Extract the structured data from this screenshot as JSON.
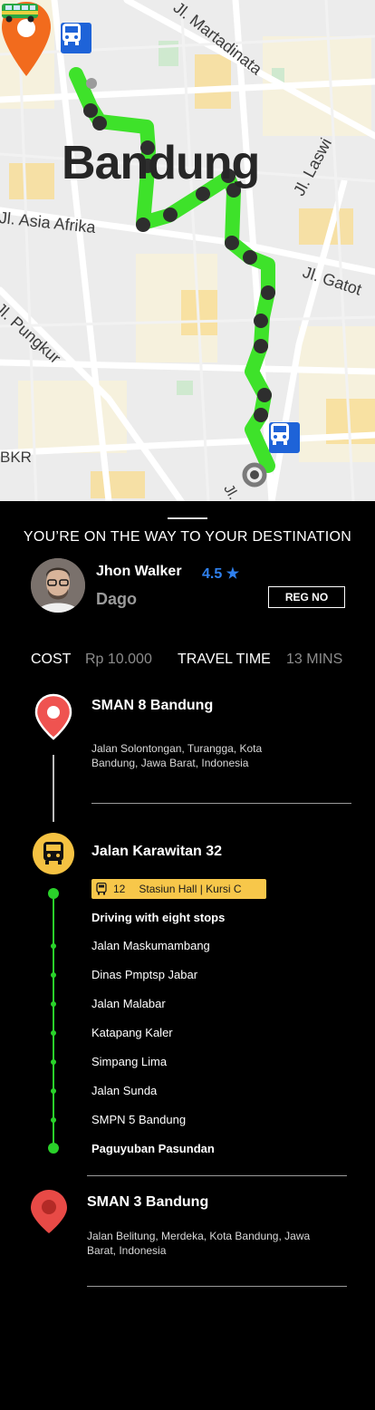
{
  "map": {
    "city_label": "Bandung",
    "street_labels": {
      "asia_afrika": "Jl. Asia Afrika",
      "laswi": "Jl. Laswi",
      "gatot": "Jl. Gatot",
      "pungkur": "Jl. Pungkur",
      "martadinata": "Jl. Martadinata",
      "bkr": "BKR",
      "jl": "Jl."
    },
    "route_color": "#3ee22a",
    "bus_stop_color": "#1e63d8",
    "destination_pin_color": "#f26b1d"
  },
  "trip": {
    "status_title": "YOU’RE ON THE WAY TO YOUR DESTINATION",
    "driver": {
      "name": "Jhon Walker",
      "rating": "4.5 ★",
      "area": "Dago",
      "reg_button": "REG NO"
    },
    "cost_label": "COST",
    "cost_value": "Rp 10.000",
    "travel_time_label": "TRAVEL TIME",
    "travel_time_value": "13 MINS"
  },
  "itinerary": {
    "origin": {
      "title": "SMAN 8 Bandung",
      "address": "Jalan Solontongan, Turangga, Kota Bandung, Jawa Barat, Indonesia"
    },
    "transit": {
      "title": "Jalan Karawitan 32",
      "route_number": "12",
      "route_desc": "Stasiun Hall | Kursi C",
      "summary": "Driving with eight stops",
      "stops": [
        "Jalan Maskumambang",
        "Dinas Pmptsp Jabar",
        "Jalan Malabar",
        "Katapang Kaler",
        "Simpang Lima",
        "Jalan Sunda",
        "SMPN 5 Bandung"
      ],
      "final_stop": "Paguyuban Pasundan",
      "line_color": "#2ad12a",
      "badge_color": "#f7c74a"
    },
    "destination": {
      "title": "SMAN 3 Bandung",
      "address": "Jalan Belitung, Merdeka, Kota Bandung, Jawa Barat, Indonesia"
    }
  }
}
